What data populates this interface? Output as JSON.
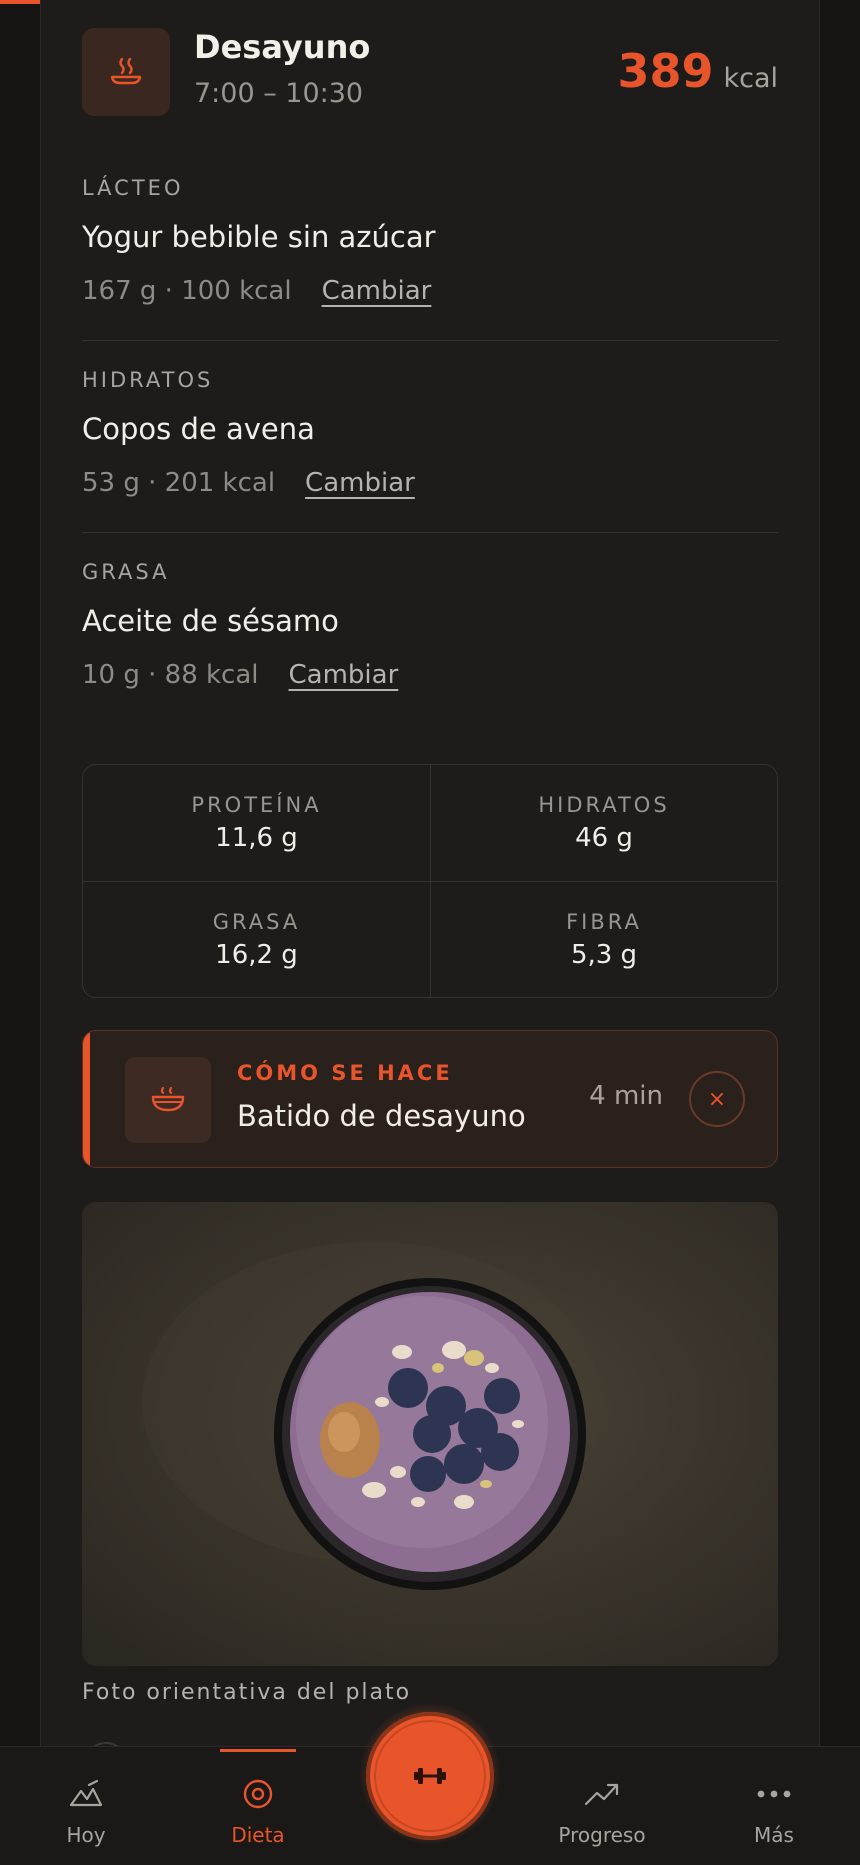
{
  "meal": {
    "title": "Desayuno",
    "time": "7:00 – 10:30",
    "kcal_value": "389",
    "kcal_unit": "kcal"
  },
  "foods": [
    {
      "category": "LÁCTEO",
      "name": "Yogur bebible sin azúcar",
      "amount": "167 g · 100 kcal",
      "change_label": "Cambiar"
    },
    {
      "category": "HIDRATOS",
      "name": "Copos de avena",
      "amount": "53 g · 201 kcal",
      "change_label": "Cambiar"
    },
    {
      "category": "GRASA",
      "name": "Aceite de sésamo",
      "amount": "10 g · 88 kcal",
      "change_label": "Cambiar"
    }
  ],
  "macros": [
    {
      "label": "PROTEÍNA",
      "value": "11,6 g"
    },
    {
      "label": "HIDRATOS",
      "value": "46 g"
    },
    {
      "label": "GRASA",
      "value": "16,2 g"
    },
    {
      "label": "FIBRA",
      "value": "5,3 g"
    }
  ],
  "recipe": {
    "kicker": "CÓMO SE HACE",
    "title": "Batido de desayuno",
    "duration": "4 min",
    "close_icon": "×"
  },
  "photo": {
    "caption": "Foto orientativa del plato"
  },
  "tabbar": {
    "tabs": [
      {
        "label": "Hoy",
        "icon": "mountain-chart-icon",
        "active": false
      },
      {
        "label": "Dieta",
        "icon": "target-icon",
        "active": true
      },
      {
        "label": "Progreso",
        "icon": "trend-up-icon",
        "active": false
      },
      {
        "label": "Más",
        "icon": "more-dots-icon",
        "active": false
      }
    ],
    "fab_icon": "dumbbell-icon"
  },
  "colors": {
    "accent": "#e8552b",
    "background": "#151413",
    "card": "#1d1c1b"
  }
}
